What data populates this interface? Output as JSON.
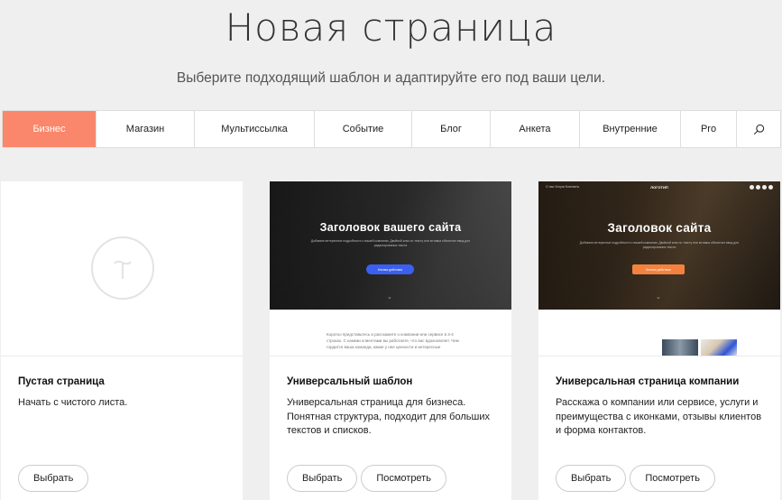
{
  "header": {
    "title": "Новая страница",
    "subtitle": "Выберите подходящий шаблон и адаптируйте его под ваши цели."
  },
  "tabs": [
    {
      "label": "Бизнес",
      "active": true
    },
    {
      "label": "Магазин"
    },
    {
      "label": "Мультиссылка"
    },
    {
      "label": "Событие"
    },
    {
      "label": "Блог"
    },
    {
      "label": "Анкета"
    },
    {
      "label": "Внутренние"
    },
    {
      "label": "Pro"
    }
  ],
  "search_icon": "search-icon",
  "accent_color": "#fa876b",
  "cards": [
    {
      "title": "Пустая страница",
      "description": "Начать с чистого листа.",
      "select_label": "Выбрать"
    },
    {
      "title": "Универсальный шаблон",
      "description": "Универсальная страница для бизнеса. Понятная структура, подходит для больших текстов и списков.",
      "select_label": "Выбрать",
      "view_label": "Посмотреть",
      "preview": {
        "hero_title": "Заголовок вашего сайта",
        "hero_sub": "Добавьте интересные подробности о вашей компании. Двойной клик по тексту или вставка обеспечат ввод для редактирования текста",
        "hero_button": "Кнопка действия",
        "body_text": "Коротко представьтесь и расскажите о компании или сервисе в 3-4 строках. С какими клиентами вы работаете, что вас вдохновляет. Чем гордится ваша команда, какие у нее ценности и интересные"
      }
    },
    {
      "title": "Универсальная страница компании",
      "description": "Расскажа о компании или сервисе, услуги и преимущества с иконками, отзывы клиентов и форма контактов.",
      "select_label": "Выбрать",
      "view_label": "Посмотреть",
      "preview": {
        "nav": "О нас    Услуги    Контакты",
        "logo": "ЛОГОТИП",
        "hero_title": "Заголовок сайта",
        "hero_sub": "Добавьте интересные подробности о вашей компании. Двойной клик по тексту или вставка обеспечат ввод для редактирования текста",
        "hero_button": "Кнопка действия"
      }
    }
  ]
}
